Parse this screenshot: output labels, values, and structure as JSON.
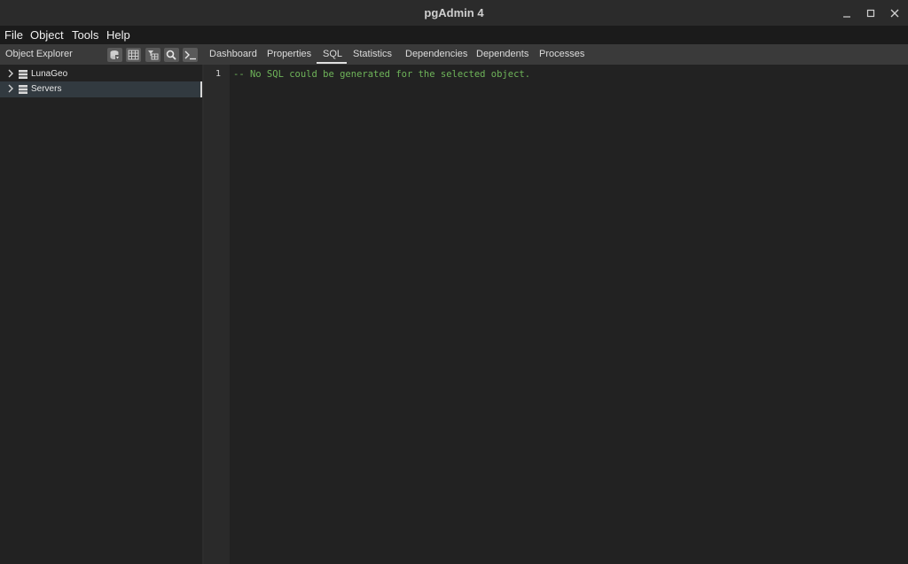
{
  "window": {
    "title": "pgAdmin 4",
    "controls": [
      "minimize-icon",
      "maximize-icon",
      "close-icon"
    ]
  },
  "menubar": {
    "items": [
      "File",
      "Object",
      "Tools",
      "Help"
    ]
  },
  "object_explorer": {
    "title": "Object Explorer",
    "toolbar_icons": [
      "query-tool-icon",
      "view-data-icon",
      "filtered-rows-icon",
      "search-objects-icon",
      "psql-tool-icon"
    ],
    "tree": [
      {
        "label": "LunaGeo",
        "icon": "server-group-icon",
        "selected": false
      },
      {
        "label": "Servers",
        "icon": "server-group-icon",
        "selected": true
      }
    ]
  },
  "tabs": {
    "items": [
      "Dashboard",
      "Properties",
      "SQL",
      "Statistics",
      "Dependencies",
      "Dependents",
      "Processes"
    ],
    "active": "SQL"
  },
  "editor": {
    "line_numbers": [
      "1"
    ],
    "lines": [
      "-- No SQL could be generated for the selected object."
    ]
  },
  "colors": {
    "comment": "#6fb55a",
    "background": "#222222",
    "toolbar": "#3a3a3a"
  }
}
